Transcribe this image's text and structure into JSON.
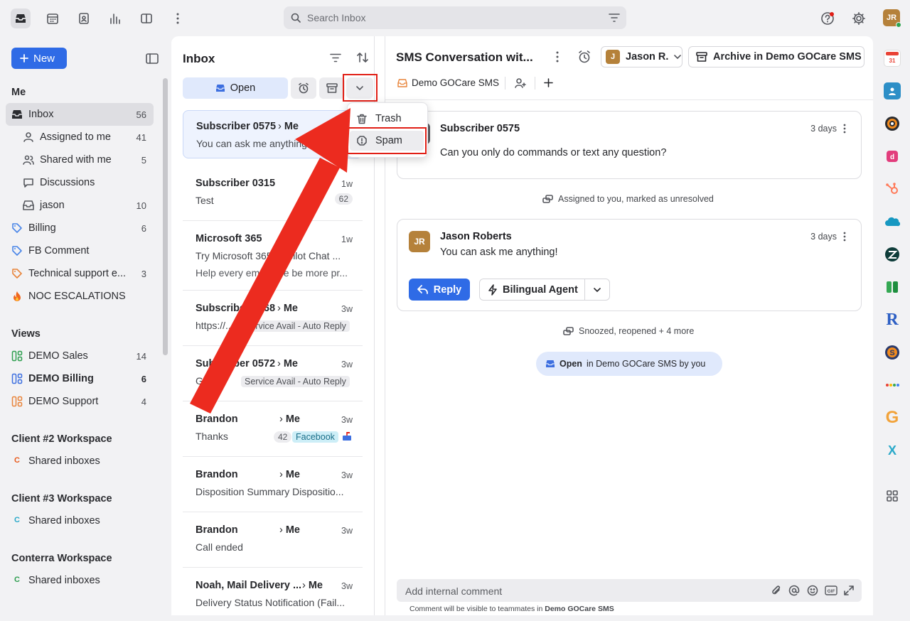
{
  "topbar": {
    "search_placeholder": "Search Inbox",
    "avatar_initials": "JR"
  },
  "sidebar": {
    "new_label": "New",
    "me_heading": "Me",
    "items": [
      {
        "label": "Inbox",
        "count": "56",
        "icon": "inbox-icon"
      },
      {
        "label": "Assigned to me",
        "count": "41",
        "icon": "assigned-icon"
      },
      {
        "label": "Shared with me",
        "count": "5",
        "icon": "users-icon"
      },
      {
        "label": "Discussions",
        "count": "",
        "icon": "chat-icon"
      },
      {
        "label": "jason",
        "count": "10",
        "icon": "inbox-icon"
      },
      {
        "label": "Billing",
        "count": "6",
        "icon": "tag-icon"
      },
      {
        "label": "FB Comment",
        "count": "",
        "icon": "tag-icon"
      },
      {
        "label": "Technical support e...",
        "count": "3",
        "icon": "tag-icon"
      },
      {
        "label": "NOC ESCALATIONS",
        "count": "",
        "icon": "fire-icon"
      }
    ],
    "views_heading": "Views",
    "views": [
      {
        "label": "DEMO Sales",
        "count": "14"
      },
      {
        "label": "DEMO Billing",
        "count": "6"
      },
      {
        "label": "DEMO Support",
        "count": "4"
      }
    ],
    "workspaces": [
      {
        "heading": "Client #2 Workspace",
        "item": "Shared inboxes",
        "letter": "C",
        "color": "#e8591a"
      },
      {
        "heading": "Client #3 Workspace",
        "item": "Shared inboxes",
        "letter": "C",
        "color": "#2aa9c9"
      },
      {
        "heading": "Conterra Workspace",
        "item": "Shared inboxes",
        "letter": "C",
        "color": "#2e9e4f"
      }
    ]
  },
  "inbox": {
    "title": "Inbox",
    "open_label": "Open",
    "dropdown": {
      "trash": "Trash",
      "spam": "Spam"
    },
    "conversations": [
      {
        "name": "Subscriber 0575",
        "me": "Me",
        "time": "",
        "preview": "You can ask me anything!"
      },
      {
        "name": "Subscriber 0315",
        "me": "",
        "time": "1w",
        "preview": "Test",
        "count": "62"
      },
      {
        "name": "Microsoft 365",
        "me": "",
        "time": "1w",
        "preview": "Try Microsoft 365 Copilot Chat ...",
        "preview2": "Help every employee be more pr..."
      },
      {
        "name": "Subscriber 0568",
        "me": "Me",
        "time": "3w",
        "preview": "https://...",
        "tag": "Service Avail - Auto Reply"
      },
      {
        "name": "Subscriber 0572",
        "me": "Me",
        "time": "3w",
        "preview": "Going",
        "tag": "Service Avail - Auto Reply"
      },
      {
        "name": "Brandon",
        "me": "Me",
        "time": "3w",
        "preview": "Thanks",
        "count": "42",
        "tag": "Facebook"
      },
      {
        "name": "Brandon",
        "me": "Me",
        "time": "3w",
        "preview": "Disposition Summary Dispositio..."
      },
      {
        "name": "Brandon",
        "me": "Me",
        "time": "3w",
        "preview": "Call ended"
      },
      {
        "name": "Noah, Mail Delivery ...",
        "me": "Me",
        "time": "3w",
        "preview": "Delivery Status Notification (Fail..."
      }
    ]
  },
  "conversation": {
    "title": "SMS Conversation wit...",
    "assignee": "Jason R.",
    "assignee_initial": "J",
    "archive_label": "Archive in Demo GOCare SMS",
    "inbox_label": "Demo GOCare SMS",
    "messages": [
      {
        "sender": "Subscriber 0575",
        "time": "3 days",
        "body": "Can you only do commands or text any question?"
      },
      {
        "sender": "Jason Roberts",
        "initials": "JR",
        "time": "3 days",
        "body": "You can ask me anything!"
      }
    ],
    "event1": "Assigned to you, marked as unresolved",
    "event2": "Snoozed, reopened + 4 more",
    "status_open": "Open",
    "status_rest": "in Demo GOCare SMS by you",
    "reply_label": "Reply",
    "agent_label": "Bilingual Agent",
    "comment_placeholder": "Add internal comment",
    "footer_prefix": "Comment will be visible to teammates in",
    "footer_inbox": "Demo GOCare SMS"
  },
  "right_apps": [
    "calendar-app",
    "contacts-app",
    "circle-app",
    "pink-app",
    "hubspot-app",
    "salesforce-app",
    "zendesk-app",
    "green-app",
    "r-app",
    "s-app",
    "dots-app",
    "g-app",
    "x-app",
    "grid-app"
  ]
}
